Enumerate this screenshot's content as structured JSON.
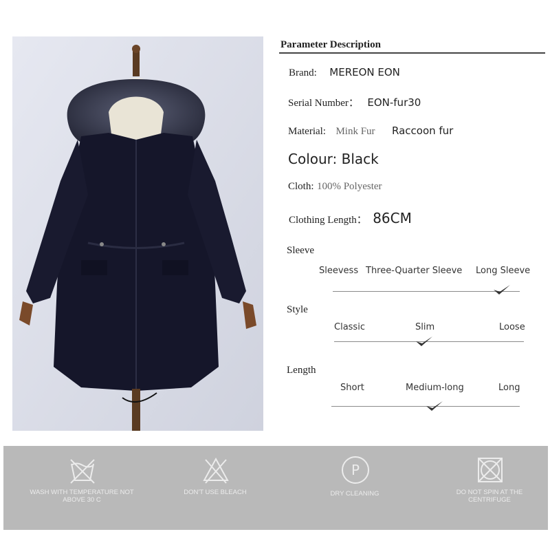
{
  "photo": {
    "alt_icon": "black-parka-with-raccoon-fur-hood"
  },
  "params": {
    "title": "Parameter Description",
    "brand": {
      "label": "Brand:",
      "value": "MEREON EON"
    },
    "serial": {
      "label": "Serial Number：",
      "value": "EON-fur30"
    },
    "material": {
      "label": "Material:",
      "value1": "Mink Fur",
      "value2": "Raccoon fur"
    },
    "colour": {
      "text": "Colour: Black"
    },
    "cloth": {
      "label": "Cloth:",
      "value": "100% Polyester"
    },
    "length": {
      "label": "Clothing Length：",
      "value": "86CM"
    }
  },
  "sleeve": {
    "title": "Sleeve",
    "options": [
      "Sleevess",
      "Three-Quarter Sleeve",
      "Long Sleeve"
    ],
    "selected": "Long Sleeve"
  },
  "style": {
    "title": "Style",
    "options": [
      "Classic",
      "Slim",
      "Loose"
    ],
    "selected": "Slim"
  },
  "garment_length": {
    "title": "Length",
    "options": [
      "Short",
      "Medium-long",
      "Long"
    ],
    "selected": "Medium-long"
  },
  "care": [
    {
      "icon": "wash-temperature-icon",
      "text": "WASH WITH TEMPERATURE NOT ABOVE 30 C"
    },
    {
      "icon": "no-bleach-icon",
      "text": "DON'T USE BLEACH"
    },
    {
      "icon": "dry-cleaning-icon",
      "text": "DRY CLEANING",
      "symbol": "P"
    },
    {
      "icon": "no-spin-icon",
      "text": "DO NOT SPIN AT THE CENTRIFUGE"
    }
  ],
  "colors": {
    "coat": "#15162a",
    "fur": "#3a3d52",
    "background": "#dcdfe9",
    "care_band": "#b9b9b9"
  }
}
